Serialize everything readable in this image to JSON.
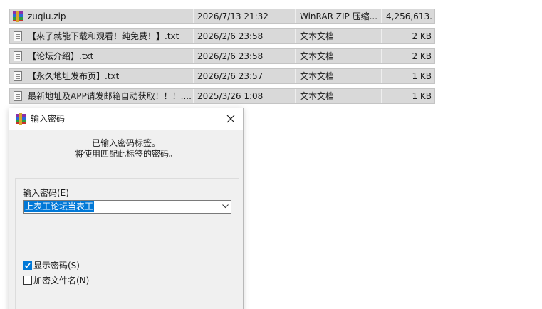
{
  "files": [
    {
      "name": "zuqiu.zip",
      "date": "2026/7/13 21:32",
      "type": "WinRAR ZIP 压缩...",
      "size": "4,256,613...",
      "icon": "winrar-icon"
    },
    {
      "name": "【来了就能下载和观看！纯免费！】.txt",
      "date": "2026/2/6 23:58",
      "type": "文本文档",
      "size": "2 KB",
      "icon": "text-file-icon"
    },
    {
      "name": "【论坛介绍】.txt",
      "date": "2026/2/6 23:58",
      "type": "文本文档",
      "size": "2 KB",
      "icon": "text-file-icon"
    },
    {
      "name": "【永久地址发布页】.txt",
      "date": "2026/2/6 23:57",
      "type": "文本文档",
      "size": "1 KB",
      "icon": "text-file-icon"
    },
    {
      "name": "最新地址及APP请发邮箱自动获取！！！....",
      "date": "2025/3/26 1:08",
      "type": "文本文档",
      "size": "1 KB",
      "icon": "text-file-icon"
    }
  ],
  "dialog": {
    "title": "输入密码",
    "info_line1": "已输入密码标签。",
    "info_line2": "将使用匹配此标签的密码。",
    "password_label": "输入密码(E)",
    "password_value": "上表王论坛当表王",
    "show_password_label": "显示密码(S)",
    "show_password_checked": true,
    "encrypt_filenames_label": "加密文件名(N)",
    "encrypt_filenames_checked": false
  },
  "colors": {
    "row_bg": "#d9d9d9",
    "selection": "#0078d7",
    "dialog_bg": "#f0f0f0"
  }
}
